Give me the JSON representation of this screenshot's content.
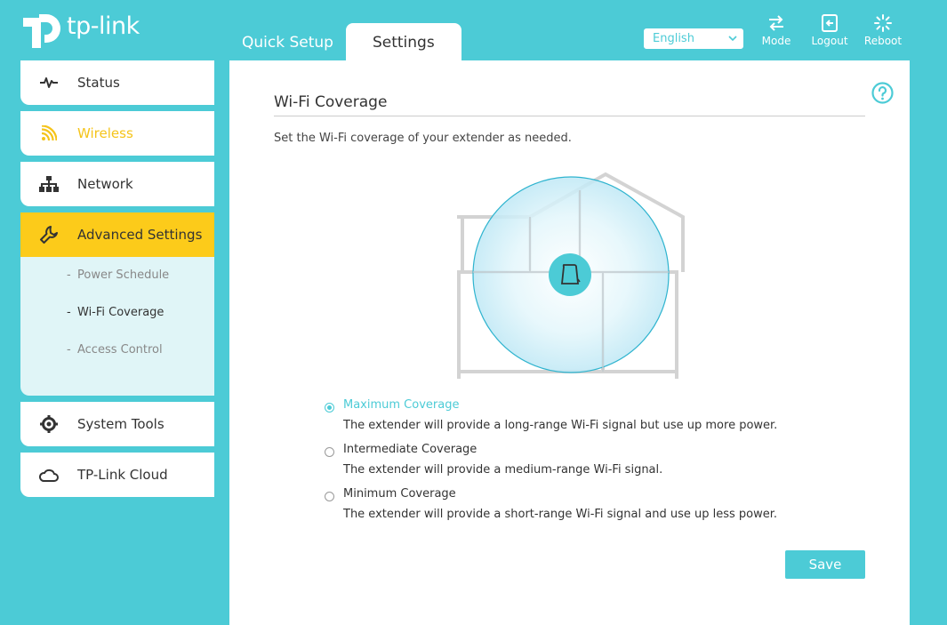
{
  "header": {
    "logo_text": "tp-link",
    "tabs": [
      {
        "label": "Quick Setup",
        "active": false
      },
      {
        "label": "Settings",
        "active": true
      }
    ],
    "language": "English",
    "buttons": {
      "mode": "Mode",
      "logout": "Logout",
      "reboot": "Reboot"
    }
  },
  "sidebar": {
    "items": [
      {
        "label": "Status",
        "icon": "pulse-icon"
      },
      {
        "label": "Wireless",
        "icon": "wifi-signal-icon"
      },
      {
        "label": "Network",
        "icon": "network-icon"
      },
      {
        "label": "Advanced Settings",
        "icon": "wrench-icon"
      },
      {
        "label": "System Tools",
        "icon": "gear-icon"
      },
      {
        "label": "TP-Link Cloud",
        "icon": "cloud-icon"
      }
    ],
    "advanced_submenu": [
      {
        "label": "Power Schedule",
        "active": false
      },
      {
        "label": "Wi-Fi Coverage",
        "active": true
      },
      {
        "label": "Access Control",
        "active": false
      }
    ]
  },
  "main": {
    "title": "Wi-Fi Coverage",
    "description": "Set the Wi-Fi coverage of your extender as needed.",
    "options": [
      {
        "label": "Maximum Coverage",
        "desc": "The extender will provide a long-range Wi-Fi signal but use up more power.",
        "selected": true
      },
      {
        "label": "Intermediate Coverage",
        "desc": "The extender will provide a medium-range Wi-Fi signal.",
        "selected": false
      },
      {
        "label": "Minimum Coverage",
        "desc": "The extender will provide a short-range Wi-Fi signal and use up less power.",
        "selected": false
      }
    ],
    "save_label": "Save"
  },
  "colors": {
    "accent": "#4ccbd6",
    "highlight": "#fccb1a",
    "wireless_text": "#f5c41a",
    "submenu_bg": "#e0f5f7"
  }
}
